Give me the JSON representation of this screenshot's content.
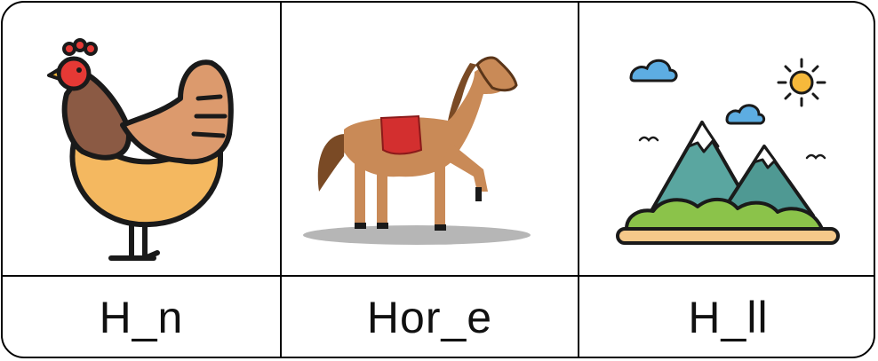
{
  "cards": [
    {
      "word": "H_n",
      "icon": "hen-icon"
    },
    {
      "word": "Hor_e",
      "icon": "horse-icon"
    },
    {
      "word": "H_ll",
      "icon": "hill-icon"
    }
  ],
  "colors": {
    "border": "#000000",
    "hen_body": "#f4b860",
    "hen_neck": "#8b5a44",
    "hen_comb": "#e53935",
    "horse": "#c98a57",
    "horse_saddle": "#d32f2f",
    "mountain": "#5aa6a0",
    "grass": "#8bc34a",
    "sun": "#f6b93b",
    "cloud": "#5dade2"
  }
}
